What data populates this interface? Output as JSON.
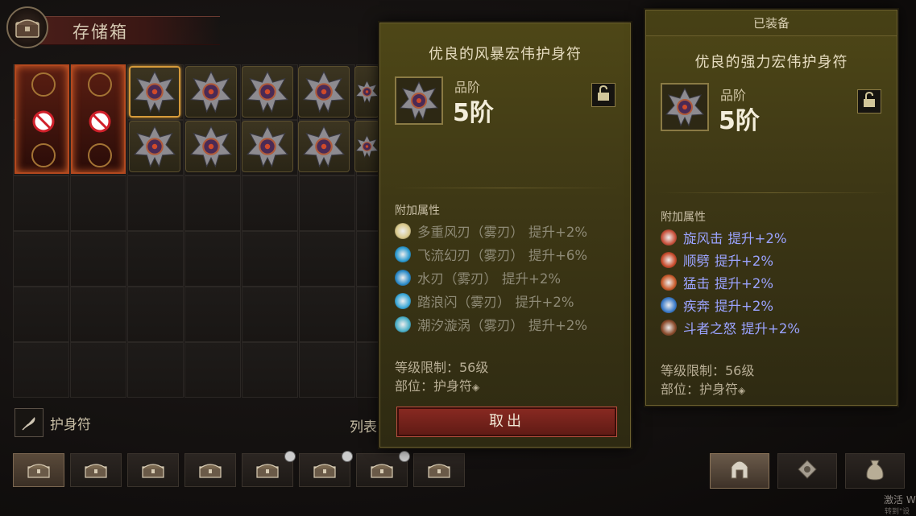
{
  "stash": {
    "title": "存储箱",
    "filter_label": "护身符",
    "list_label": "列表"
  },
  "hovered_item": {
    "name": "优良的风暴宏伟护身符",
    "grade_label": "品阶",
    "grade_value": "5阶",
    "attributes_header": "附加属性",
    "affixes": [
      {
        "name": "多重风刃（雾刃）",
        "bonus": "提升+2%",
        "icon": "moon-blade-icon",
        "active": false
      },
      {
        "name": "飞流幻刃（雾刃）",
        "bonus": "提升+6%",
        "icon": "water-blade-icon",
        "active": false
      },
      {
        "name": "水刃（雾刃）",
        "bonus": "提升+2%",
        "icon": "water-drop-icon",
        "active": false
      },
      {
        "name": "踏浪闪（雾刃）",
        "bonus": "提升+2%",
        "icon": "wave-dash-icon",
        "active": false
      },
      {
        "name": "潮汐漩涡（雾刃）",
        "bonus": "提升+2%",
        "icon": "vortex-icon",
        "active": false
      }
    ],
    "level_req": "等级限制：56级",
    "slot": "部位：护身符",
    "take_out_label": "取出"
  },
  "equipped_item": {
    "header": "已装备",
    "name": "优良的强力宏伟护身符",
    "grade_label": "品阶",
    "grade_value": "5阶",
    "attributes_header": "附加属性",
    "affixes": [
      {
        "name": "旋风击",
        "bonus": "提升+2%",
        "icon": "whirlwind-icon",
        "active": true
      },
      {
        "name": "顺劈",
        "bonus": "提升+2%",
        "icon": "cleave-icon",
        "active": true
      },
      {
        "name": "猛击",
        "bonus": "提升+2%",
        "icon": "slam-icon",
        "active": true
      },
      {
        "name": "疾奔",
        "bonus": "提升+2%",
        "icon": "sprint-icon",
        "active": true
      },
      {
        "name": "斗者之怒",
        "bonus": "提升+2%",
        "icon": "fury-icon",
        "active": true
      }
    ],
    "level_req": "等级限制：56级",
    "slot": "部位：护身符"
  },
  "bottom_tabs": {
    "count": 8,
    "active_index": 0,
    "clock_tabs": [
      4,
      5,
      6
    ]
  },
  "right_tabs": [
    "helmet-icon",
    "charm-icon",
    "bag-icon"
  ],
  "system_watermark": {
    "line1": "激活 W",
    "line2": "转到\"设"
  },
  "colors": {
    "affix_active": "#9ba3ff",
    "affix_dim": "#8e8a76",
    "tooltip_bg": "#3d3715",
    "take_button": "#8a2a22"
  }
}
